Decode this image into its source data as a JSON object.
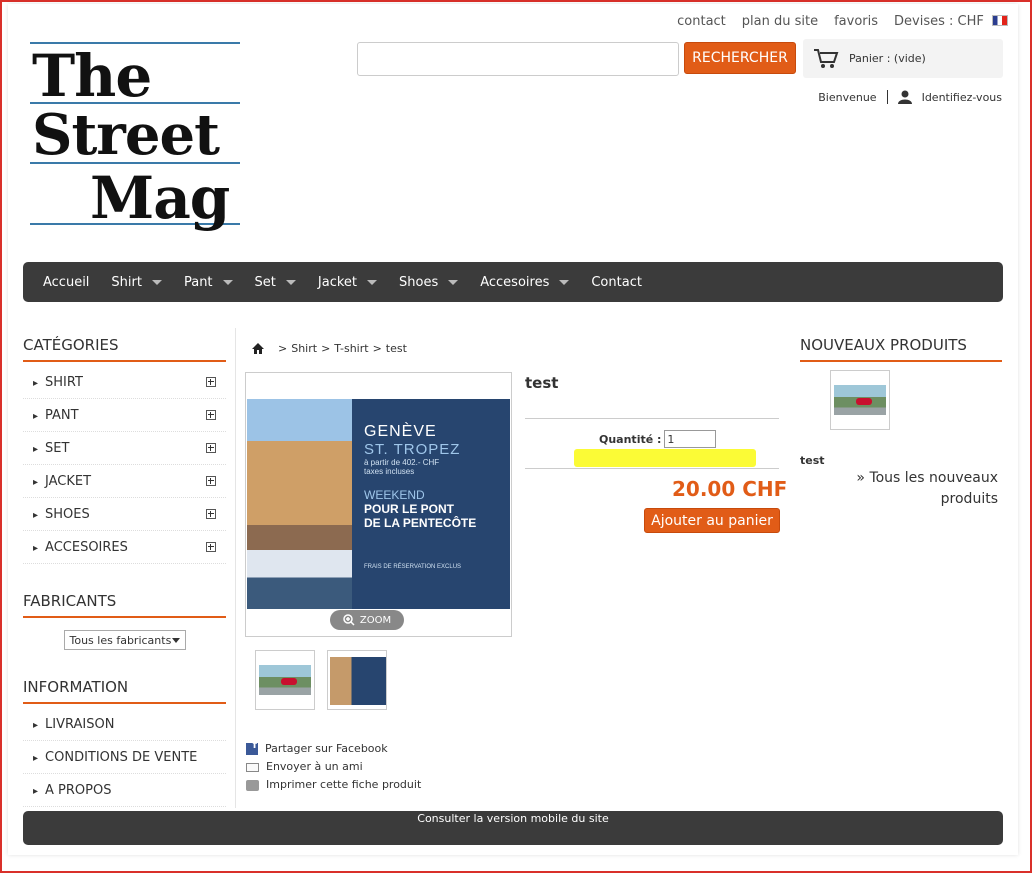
{
  "header": {
    "links": [
      "contact",
      "plan du site",
      "favoris"
    ],
    "currency_label": "Devises : CHF",
    "logo_lines": [
      "The",
      "Street",
      "Mag"
    ],
    "search": {
      "placeholder": "",
      "button_label": "RECHERCHER"
    },
    "cart_label": "Panier : (vide)",
    "welcome": "Bienvenue",
    "login": "Identifiez-vous"
  },
  "nav": {
    "items": [
      {
        "label": "Accueil",
        "has_menu": false
      },
      {
        "label": "Shirt",
        "has_menu": true
      },
      {
        "label": "Pant",
        "has_menu": true
      },
      {
        "label": "Set",
        "has_menu": true
      },
      {
        "label": "Jacket",
        "has_menu": true
      },
      {
        "label": "Shoes",
        "has_menu": true
      },
      {
        "label": "Accesoires",
        "has_menu": true
      },
      {
        "label": "Contact",
        "has_menu": false
      }
    ]
  },
  "categories": {
    "title": "CATÉGORIES",
    "items": [
      "SHIRT",
      "PANT",
      "SET",
      "JACKET",
      "SHOES",
      "ACCESOIRES"
    ]
  },
  "manufacturers": {
    "title": "FABRICANTS",
    "selected": "Tous les fabricants"
  },
  "information": {
    "title": "INFORMATION",
    "items": [
      "LIVRAISON",
      "CONDITIONS DE VENTE",
      "A PROPOS"
    ]
  },
  "breadcrumb": [
    "Shirt",
    "T-shirt",
    "test"
  ],
  "product": {
    "name": "test",
    "quantity_label": "Quantité :",
    "quantity_value": "1",
    "price": "20.00 CHF",
    "add_to_cart": "Ajouter au panier",
    "zoom_label": "ZOOM",
    "promo": {
      "line1": "GENÈVE",
      "line2": "ST. TROPEZ",
      "line3": "à partir de 402.- CHF",
      "line4": "taxes incluses",
      "line5": "WEEKEND",
      "line6": "POUR LE PONT",
      "line7": "DE LA PENTECÔTE",
      "line8": "FRAIS DE RÉSERVATION EXCLUS"
    }
  },
  "share": {
    "facebook": "Partager sur Facebook",
    "email": "Envoyer à un ami",
    "print": "Imprimer cette fiche produit"
  },
  "new_products": {
    "title": "NOUVEAUX PRODUITS",
    "item_name": "test",
    "all_link": "» Tous les nouveaux produits"
  },
  "footer": {
    "mobile_link": "Consulter la version mobile du site"
  },
  "colors": {
    "accent": "#e15c17",
    "nav_bg": "#3b3b3b",
    "highlight": "#fbfb2b"
  }
}
